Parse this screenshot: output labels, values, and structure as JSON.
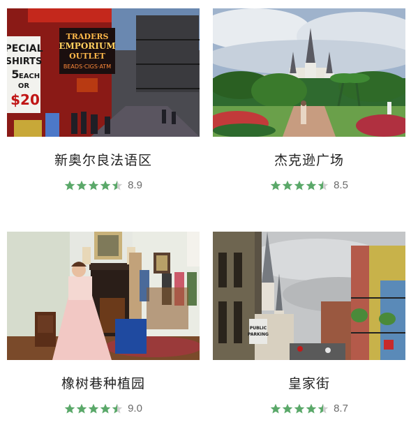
{
  "colors": {
    "star_full": "#5aa869",
    "star_empty": "#d0d0d0",
    "title": "#222222",
    "score": "#6b6b6b"
  },
  "cards": [
    {
      "title": "新奥尔良法语区",
      "rating": 4.5,
      "score": "8.9",
      "image": "french-quarter-street-neon-signs",
      "sign_lines": [
        "TRADERS",
        "EMPORIUM",
        "OUTLET",
        "BEADS·CIGS·ATM"
      ],
      "poster_lines": [
        "PECIAL",
        "SHIRTS",
        "5",
        "EACH",
        "OR",
        "$20"
      ]
    },
    {
      "title": "杰克逊广场",
      "rating": 4.5,
      "score": "8.5",
      "image": "cathedral-and-garden-square"
    },
    {
      "title": "橡树巷种植园",
      "rating": 4.5,
      "score": "9.0",
      "image": "plantation-interior-guide"
    },
    {
      "title": "皇家街",
      "rating": 4.5,
      "score": "8.7",
      "image": "royal-street-cathedral-view",
      "sign_lines": [
        "PUBLIC",
        "PARKING"
      ]
    }
  ]
}
